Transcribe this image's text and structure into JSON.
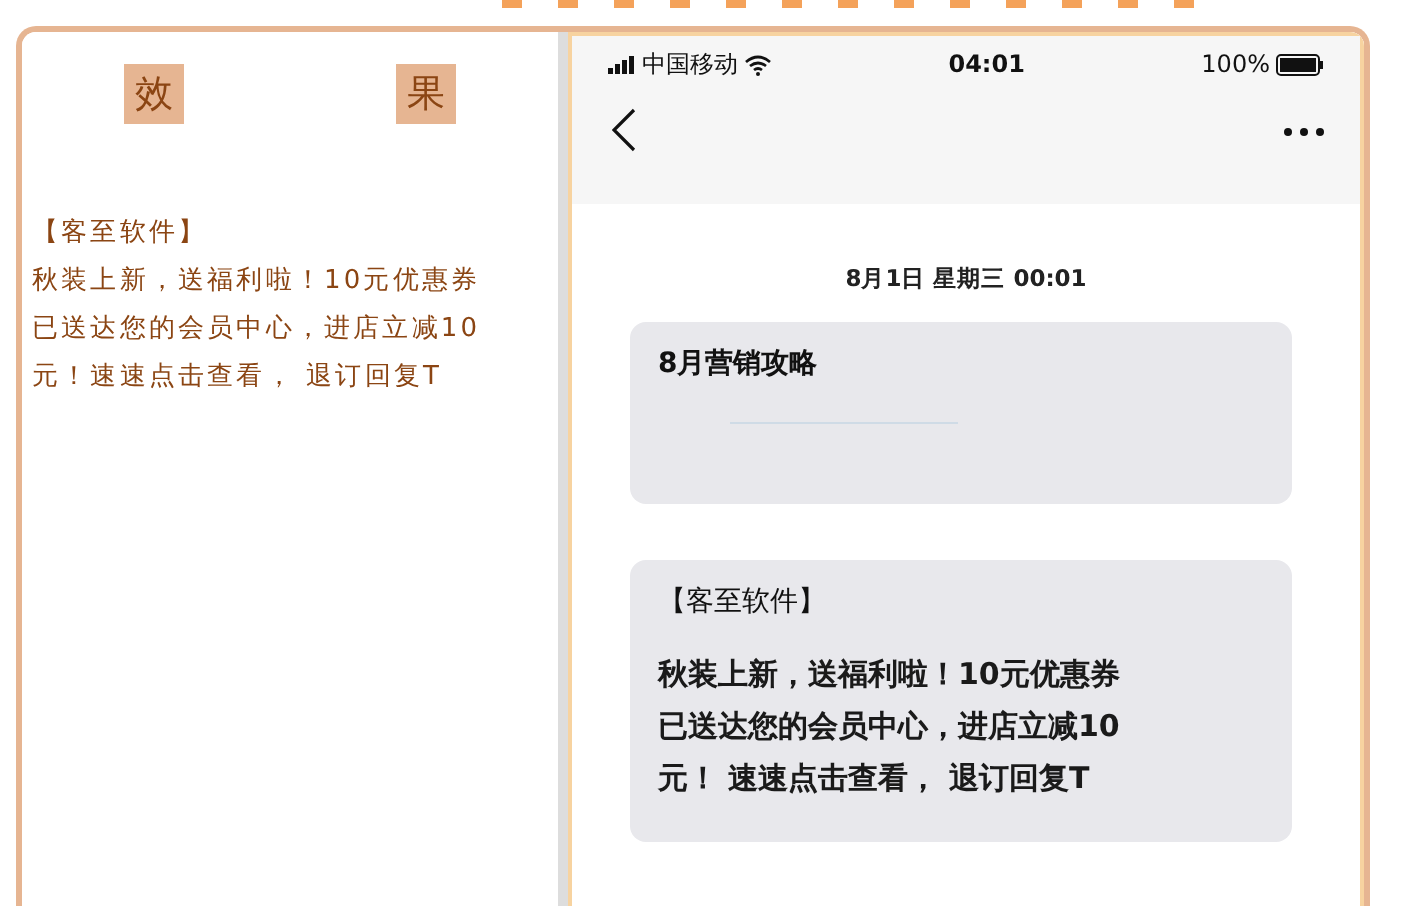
{
  "title_chars": [
    "效",
    "果"
  ],
  "preview": {
    "header": "【客至软件】",
    "lines": [
      "秋装上新，送福利啦！10元优惠券",
      "已送达您的会员中心，进店立减10",
      "元！速速点击查看， 退订回复T"
    ]
  },
  "status_bar": {
    "carrier": "中国移动",
    "time": "04:01",
    "battery": "100%"
  },
  "date": "8月1日 星期三 00:01",
  "messages": [
    {
      "kind": "link",
      "title": "8月营销攻略"
    },
    {
      "kind": "text",
      "header": "【客至软件】",
      "lines": [
        "秋装上新，送福利啦！10元优惠券",
        "已送达您的会员中心，进店立减10",
        "元！ 速速点击查看， 退订回复T"
      ]
    }
  ]
}
